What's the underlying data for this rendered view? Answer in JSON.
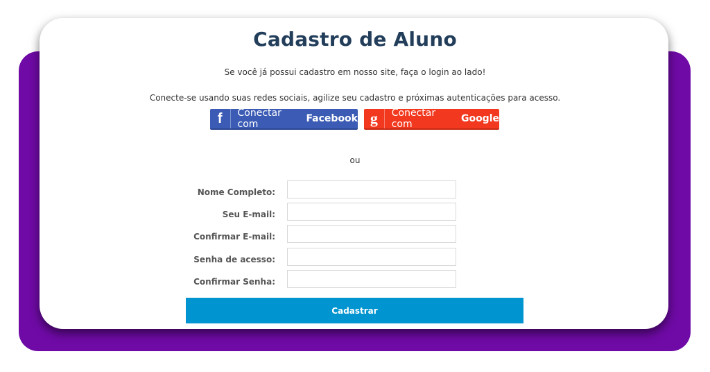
{
  "page": {
    "title": "Cadastro de Aluno",
    "login_hint": "Se você já possui cadastro em nosso site, faça o login ao lado!",
    "social_hint": "Conecte-se usando suas redes sociais, agilize seu cadastro e próximas autenticações para acesso.",
    "separator": "ou"
  },
  "social": {
    "facebook": {
      "icon": "facebook-icon",
      "glyph": "f",
      "label_prefix": "Conectar com",
      "label_brand": "Facebook",
      "color": "#3b5bb5"
    },
    "google": {
      "icon": "google-icon",
      "glyph": "g",
      "label_prefix": "Conectar com",
      "label_brand": "Google",
      "color": "#f2391f"
    }
  },
  "form": {
    "fields": [
      {
        "label": "Nome Completo:",
        "value": "",
        "placeholder": ""
      },
      {
        "label": "Seu E-mail:",
        "value": "",
        "placeholder": ""
      },
      {
        "label": "Confirmar E-mail:",
        "value": "",
        "placeholder": ""
      },
      {
        "label": "Senha de acesso:",
        "value": "",
        "placeholder": ""
      },
      {
        "label": "Confirmar Senha:",
        "value": "",
        "placeholder": ""
      }
    ],
    "submit_label": "Cadastrar"
  },
  "colors": {
    "backdrop": "#6f0aa6",
    "title": "#233e5b",
    "submit": "#0094d0"
  }
}
